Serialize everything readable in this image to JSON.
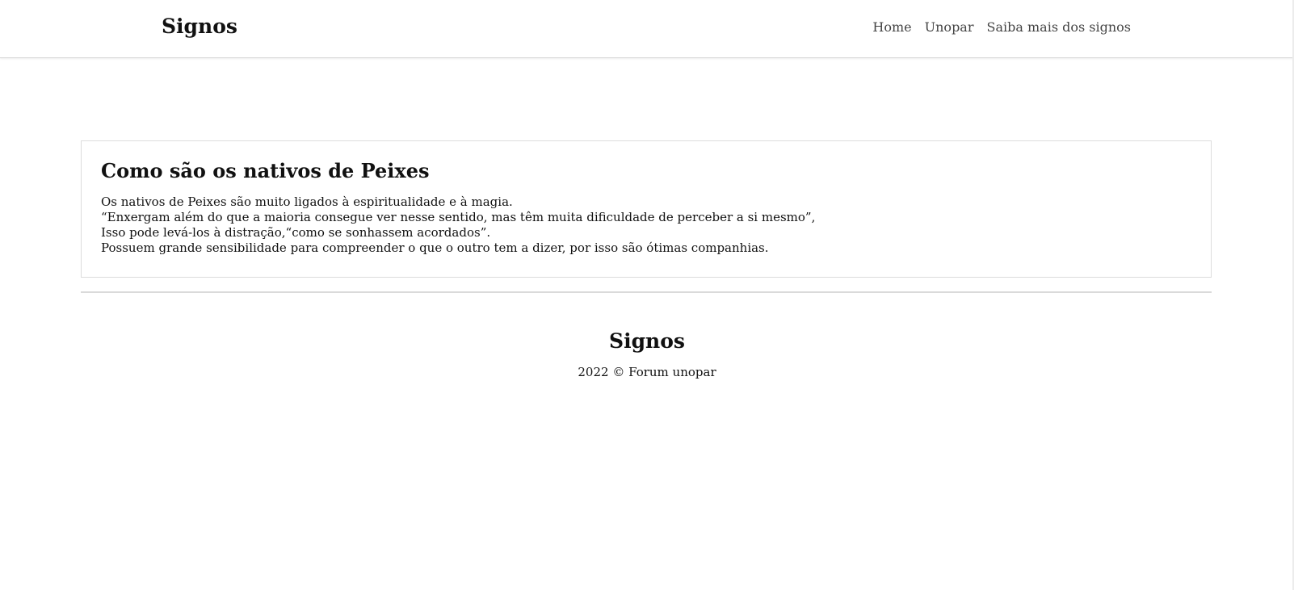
{
  "navbar": {
    "brand": "Signos",
    "links": [
      {
        "label": "Home"
      },
      {
        "label": "Unopar"
      },
      {
        "label": "Saiba mais dos signos"
      }
    ]
  },
  "card": {
    "title": "Como são os nativos de Peixes",
    "lines": [
      "Os nativos de Peixes são muito ligados à espiritualidade e à magia.",
      "“Enxergam além do que a maioria consegue ver nesse sentido, mas têm muita dificuldade de perceber a si mesmo”,",
      "Isso pode levá-los à distração,“como se sonhassem acordados”.",
      "Possuem grande sensibilidade para compreender o que o outro tem a dizer, por isso são ótimas companhias."
    ]
  },
  "footer": {
    "title": "Signos",
    "copyright": "2022 © Forum unopar"
  }
}
